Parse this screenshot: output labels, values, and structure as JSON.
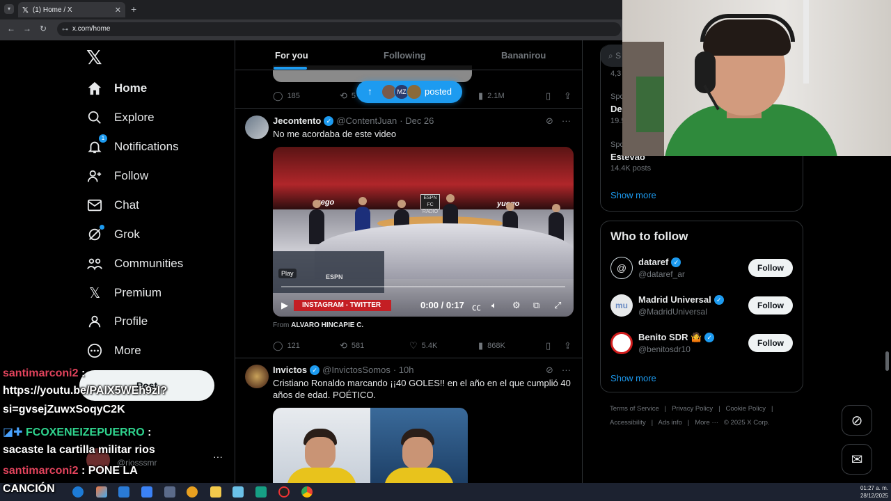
{
  "browser": {
    "tab_title": "(1) Home / X",
    "url": "x.com/home",
    "new_tab": "+",
    "tab_close": "✕"
  },
  "nav": {
    "logo": "𝕏",
    "items": [
      {
        "label": "Home",
        "icon": "home-icon"
      },
      {
        "label": "Explore",
        "icon": "search-icon"
      },
      {
        "label": "Notifications",
        "icon": "bell-icon",
        "badge": "1"
      },
      {
        "label": "Follow",
        "icon": "person-plus-icon"
      },
      {
        "label": "Chat",
        "icon": "mail-icon"
      },
      {
        "label": "Grok",
        "icon": "grok-icon"
      },
      {
        "label": "Communities",
        "icon": "communities-icon"
      },
      {
        "label": "Premium",
        "icon": "x-icon"
      },
      {
        "label": "Profile",
        "icon": "person-icon"
      },
      {
        "label": "More",
        "icon": "more-circle-icon"
      }
    ],
    "post_label": "Post",
    "account_handle": "@riosssmr",
    "account_more": "···"
  },
  "chat_overlay": [
    {
      "user": "santimarconi2",
      "text": ":"
    },
    {
      "user": "",
      "text": "https://youtu.be/PAIX5WEh9zI?"
    },
    {
      "user": "",
      "text": "si=gvsejZuwxSoqyC2K"
    },
    {
      "user": "FCOXENEIZEPUERRO",
      "text": ":"
    },
    {
      "user": "",
      "text": "sacaste la cartilla militar rios"
    },
    {
      "user": "santimarconi2",
      "text": ": PONE LA"
    },
    {
      "user": "",
      "text": "CANCIÓN"
    }
  ],
  "feed": {
    "tabs": [
      "For you",
      "Following",
      "Bananirou"
    ],
    "new_posts_pill": "posted",
    "prev_tweet_stats": {
      "replies": "185",
      "retweets": "5",
      "views": "2.1M"
    },
    "tweets": [
      {
        "name": "Jecontento",
        "handle": "@ContentJuan",
        "date": "· Dec 26",
        "text": "No me acordaba de este video",
        "video": {
          "play_label": "Play",
          "time": "0:00 / 0:17",
          "banner": "INSTAGRAM - TWITTER",
          "screen_logo": "ESPN",
          "studio_logo": "ESPN FC RADIO",
          "wall_text_left": "uego",
          "wall_text_right": "yuego"
        },
        "from_prefix": "From",
        "from_name": "ALVARO HINCAPIE C.",
        "stats": {
          "replies": "121",
          "retweets": "581",
          "likes": "5.4K",
          "views": "868K"
        }
      },
      {
        "name": "Invictos",
        "handle": "@InvictosSomos",
        "date": "· 10h",
        "text": "Cristiano Ronaldo marcando ¡¡40 GOLES!! en el año en el que cumplió 40 años de edad. POÉTICO."
      }
    ]
  },
  "right": {
    "search_placeholder": "S",
    "trends": [
      {
        "meta": "4,3",
        "name": ""
      },
      {
        "meta": "Spo",
        "name": "Del"
      },
      {
        "meta": "19.5",
        "name": ""
      },
      {
        "meta": "Spo",
        "name": "Estevão",
        "count": "14.4K posts"
      }
    ],
    "show_more": "Show more",
    "who_to_follow_title": "Who to follow",
    "suggestions": [
      {
        "name": "dataref",
        "handle": "@dataref_ar",
        "follow": "Follow"
      },
      {
        "name": "Madrid Universal",
        "handle": "@MadridUniversal",
        "follow": "Follow"
      },
      {
        "name": "Benito SDR 🤷",
        "handle": "@benitosdr10",
        "follow": "Follow"
      }
    ],
    "footer_line1": [
      "Terms of Service",
      "|",
      "Privacy Policy",
      "|",
      "Cookie Policy",
      "|"
    ],
    "footer_line2": [
      "Accessibility",
      "|",
      "Ads info",
      "|",
      "More ···",
      "© 2025 X Corp."
    ]
  },
  "taskbar": {
    "time": "01:27 a. m.",
    "date": "28/12/2025"
  },
  "colors": {
    "accent": "#1d9bf0",
    "background": "#000000",
    "text": "#e7e9ea",
    "muted": "#71767b"
  }
}
